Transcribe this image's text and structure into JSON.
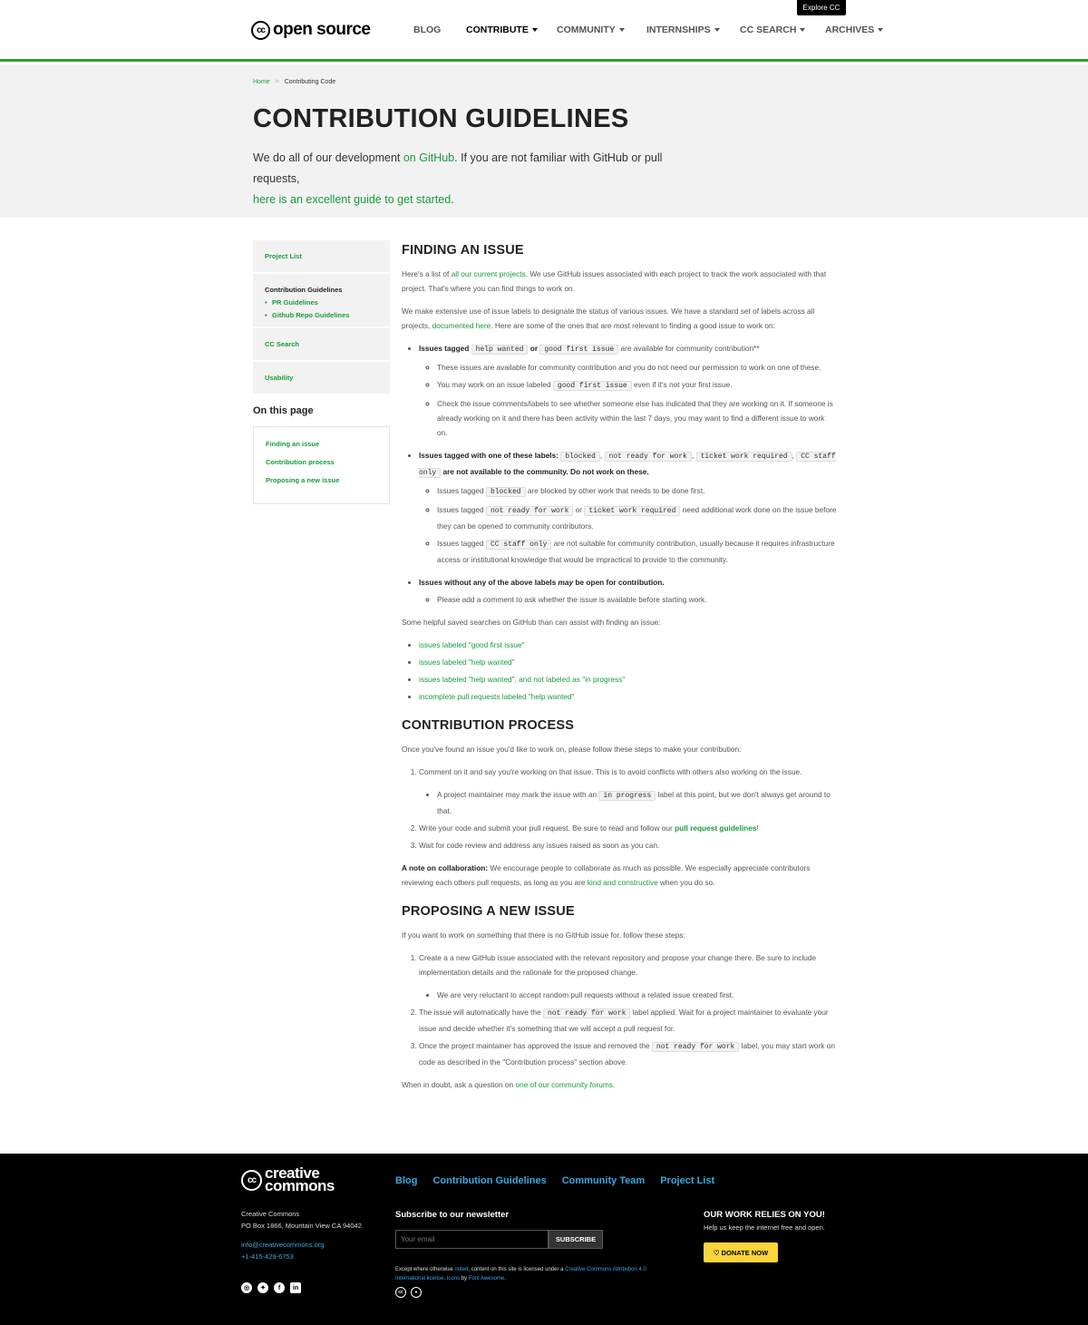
{
  "explore": "Explore CC",
  "logo": {
    "cc": "cc",
    "text": "open source"
  },
  "nav": [
    {
      "label": "BLOG",
      "caret": false
    },
    {
      "label": "CONTRIBUTE",
      "caret": true
    },
    {
      "label": "COMMUNITY",
      "caret": true
    },
    {
      "label": "INTERNSHIPS",
      "caret": true
    },
    {
      "label": "CC SEARCH",
      "caret": true
    },
    {
      "label": "ARCHIVES",
      "caret": true
    }
  ],
  "breadcrumb": {
    "home": "Home",
    "sep": ">",
    "current": "Contributing Code"
  },
  "hero": {
    "title": "CONTRIBUTION GUIDELINES",
    "intro_a": "We do all of our development ",
    "intro_link1": "on GitHub",
    "intro_b": ". If you are not familiar with GitHub or pull requests,",
    "intro_link2": "here is an excellent guide to get started",
    "intro_c": "."
  },
  "sidebar": {
    "project_list": "Project List",
    "contribution_guidelines": "Contribution Guidelines",
    "pr_guidelines": "PR Guidelines",
    "github_repo_guidelines": "Github Repo Guidelines",
    "cc_search": "CC Search",
    "usability": "Usability",
    "on_this_page": "On this page",
    "toc": [
      "Finding an issue",
      "Contribution process",
      "Proposing a new issue"
    ]
  },
  "s1": {
    "title": "FINDING AN ISSUE",
    "p1a": "Here's a list of ",
    "p1link": "all our current projects",
    "p1b": ". We use GitHub issues associated with each project to track the work associated with that project. That's where you can find things to work on.",
    "p2a": "We make extensive use of issue labels to designate the status of various issues. We have a standard set of labels across all projects, ",
    "p2link": "documented here",
    "p2b": ". Here are some of the ones that are most relevant to finding a good issue to work on:",
    "b1_a": "Issues tagged ",
    "b1_code1": "help wanted",
    "b1_or": " or ",
    "b1_code2": "good first issue",
    "b1_b": " are available for community contribution**",
    "b1_s1": "These issues are available for community contribution and you do not need our permission to work on one of these.",
    "b1_s2a": "You may work on an issue labeled ",
    "b1_s2code": "good first issue",
    "b1_s2b": " even if it's not your first issue.",
    "b1_s3": "Check the issue comments/labels to see whether someone else has indicated that they are working on it. If someone is already working on it and there has been activity within the last 7 days, you may want to find a different issue to work on.",
    "b2_a": "Issues tagged with one of these labels: ",
    "b2_c1": "blocked",
    "b2_c2": "not ready for work",
    "b2_c3": "ticket work required",
    "b2_c4": "CC staff only",
    "b2_b": " are not available to the community. Do not work on these.",
    "b2_s1a": "Issues tagged ",
    "b2_s1code": "blocked",
    "b2_s1b": " are blocked by other work that needs to be done first.",
    "b2_s2a": "Issues tagged ",
    "b2_s2code1": "not ready for work",
    "b2_s2or": " or ",
    "b2_s2code2": "ticket work required",
    "b2_s2b": " need additional work done on the issue before they can be opened to community contributors.",
    "b2_s3a": "Issues tagged ",
    "b2_s3code": "CC staff only",
    "b2_s3b": " are not suitable for community contribution, usually because it requires infrastructure access or institutional knowledge that would be impractical to provide to the community.",
    "b3_a": "Issues without any of the above labels ",
    "b3_em": "may",
    "b3_b": " be open for contribution.",
    "b3_s1": "Please add a comment to ask whether the issue is available before starting work.",
    "p3": "Some helpful saved searches on GitHub than can assist with finding an issue:",
    "links": [
      "issues labeled \"good first issue\"",
      "issues labeled \"help wanted\"",
      "issues labeled \"help wanted\", and not labeled as \"in progress\"",
      "incomplete pull requests labeled \"help wanted\""
    ]
  },
  "s2": {
    "title": "CONTRIBUTION PROCESS",
    "p1": "Once you've found an issue you'd like to work on, please follow these steps to make your contribution:",
    "o1": "Comment on it and say you're working on that issue. This is to avoid conflicts with others also working on the issue.",
    "o1s_a": "A project maintainer may mark the issue with an ",
    "o1s_code": "in progress",
    "o1s_b": " label at this point, but we don't always get around to that.",
    "o2a": "Write your code and submit your pull request. Be sure to read and follow our ",
    "o2link": "pull request guidelines",
    "o2b": "!",
    "o3": "Wait for code review and address any issues raised as soon as you can.",
    "note_b": "A note on collaboration:",
    "note_a": " We encourage people to collaborate as much as possible. We especially appreciate contributors reviewing each others pull requests, as long as you are ",
    "note_link": "kind and constructive",
    "note_c": " when you do so."
  },
  "s3": {
    "title": "PROPOSING A NEW ISSUE",
    "p1": "If you want to work on something that there is no GitHub issue for, follow these steps:",
    "o1": "Create a a new GitHub issue associated with the relevant repository and propose your change there. Be sure to include implementation details and the rationale for the proposed change.",
    "o1s": "We are very reluctant to accept random pull requests without a related issue created first.",
    "o2a": "The issue will automatically have the ",
    "o2code": "not ready for work",
    "o2b": " label applied. Wait for a project maintainer to evaluate your issue and decide whether it's something that we will accept a pull request for.",
    "o3a": "Once the project maintainer has approved the issue and removed the ",
    "o3code": "not ready for work",
    "o3b": " label, you may start work on code as described in the \"Contribution process\" section above.",
    "p2a": "When in doubt, ask a question on ",
    "p2link": "one of our community forums",
    "p2b": "."
  },
  "footer": {
    "logo_cc": "cc",
    "logo_line1": "creative",
    "logo_line2": "commons",
    "links": [
      "Blog",
      "Contribution Guidelines",
      "Community Team",
      "Project List"
    ],
    "org": "Creative Commons",
    "address": "PO Box 1866, Mountain View CA 94042",
    "email": "info@creativecommons.org",
    "phone": "+1-415-429-6753",
    "newsletter_title": "Subscribe to our newsletter",
    "email_placeholder": "Your email",
    "subscribe": "SUBSCRIBE",
    "lic_a": "Except where otherwise ",
    "lic_link1": "noted",
    "lic_b": ", content on this site is licensed under a ",
    "lic_link2": "Creative Commons Attribution 4.0 International license",
    "lic_c": ". ",
    "lic_link3": "Icons",
    "lic_d": " by ",
    "lic_link4": "Font Awesome",
    "lic_e": ".",
    "donate_title": "OUR WORK RELIES ON YOU!",
    "donate_sub": "Help us keep the internet free and open.",
    "donate_btn": "DONATE NOW"
  }
}
